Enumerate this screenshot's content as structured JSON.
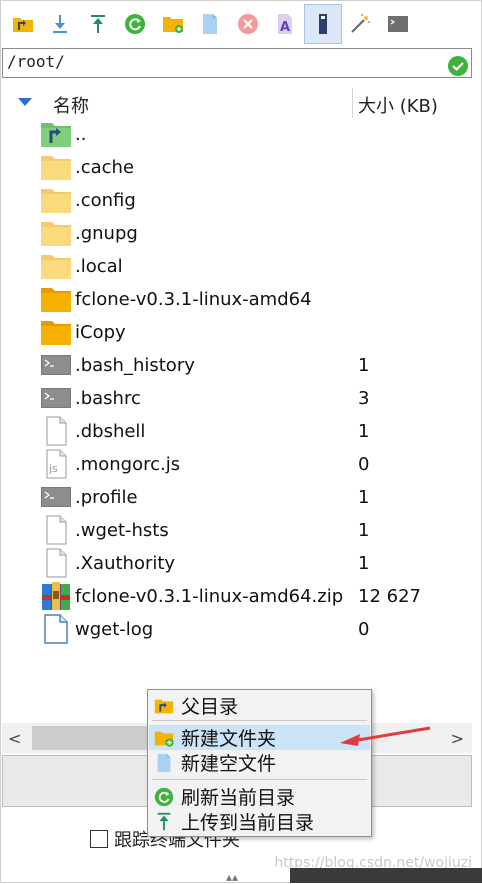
{
  "toolbar": {
    "buttons": [
      {
        "icon": "parent-folder-icon",
        "label": ""
      },
      {
        "icon": "download-icon",
        "label": ""
      },
      {
        "icon": "upload-icon",
        "label": ""
      },
      {
        "icon": "refresh-icon",
        "label": ""
      },
      {
        "icon": "new-folder-icon",
        "label": ""
      },
      {
        "icon": "new-file-icon",
        "label": ""
      },
      {
        "icon": "delete-icon",
        "label": ""
      },
      {
        "icon": "rename-icon",
        "label": ""
      },
      {
        "icon": "usb-drive-icon",
        "label": ""
      },
      {
        "icon": "magic-wand-icon",
        "label": ""
      },
      {
        "icon": "terminal-icon",
        "label": ""
      }
    ]
  },
  "path": {
    "value": "/root/"
  },
  "header": {
    "name_col": "名称",
    "size_col": "大小 (KB)"
  },
  "files": [
    {
      "name": "..",
      "size": "",
      "icon": "parent-folder-icon"
    },
    {
      "name": ".cache",
      "size": "",
      "icon": "folder-icon"
    },
    {
      "name": ".config",
      "size": "",
      "icon": "folder-icon"
    },
    {
      "name": ".gnupg",
      "size": "",
      "icon": "folder-icon"
    },
    {
      "name": ".local",
      "size": "",
      "icon": "folder-icon"
    },
    {
      "name": "fclone-v0.3.1-linux-amd64",
      "size": "",
      "icon": "folder-dark-icon"
    },
    {
      "name": "iCopy",
      "size": "",
      "icon": "folder-dark-icon"
    },
    {
      "name": ".bash_history",
      "size": "1",
      "icon": "terminal-file-icon"
    },
    {
      "name": ".bashrc",
      "size": "3",
      "icon": "terminal-file-icon"
    },
    {
      "name": ".dbshell",
      "size": "1",
      "icon": "blank-file-icon"
    },
    {
      "name": ".mongorc.js",
      "size": "0",
      "icon": "js-file-icon"
    },
    {
      "name": ".profile",
      "size": "1",
      "icon": "terminal-file-icon"
    },
    {
      "name": ".wget-hsts",
      "size": "1",
      "icon": "blank-file-icon"
    },
    {
      "name": ".Xauthority",
      "size": "1",
      "icon": "blank-file-icon"
    },
    {
      "name": "fclone-v0.3.1-linux-amd64.zip",
      "size": "12 627",
      "icon": "zip-archive-icon"
    },
    {
      "name": "wget-log",
      "size": "0",
      "icon": "document-icon"
    }
  ],
  "scrollbar": {
    "left": "<",
    "right": ">"
  },
  "follow_terminal": {
    "label": "跟踪终端文件夹",
    "checked": false
  },
  "context_menu": {
    "items": [
      {
        "label": "父目录",
        "icon": "parent-folder-icon"
      },
      {
        "label": "新建文件夹",
        "icon": "new-folder-icon",
        "highlighted": true
      },
      {
        "label": "新建空文件",
        "icon": "new-file-icon"
      },
      {
        "label": "刷新当前目录",
        "icon": "refresh-icon"
      },
      {
        "label": "上传到当前目录",
        "icon": "upload-icon"
      }
    ]
  },
  "watermark": "https://blog.csdn.net/wojiuzi",
  "colors": {
    "accent": "#2a6fd6",
    "folder": "#f9c74f",
    "folder_dark": "#f4a100",
    "menu_hover": "#cce4f7",
    "annotation_arrow": "#e23b3b"
  }
}
